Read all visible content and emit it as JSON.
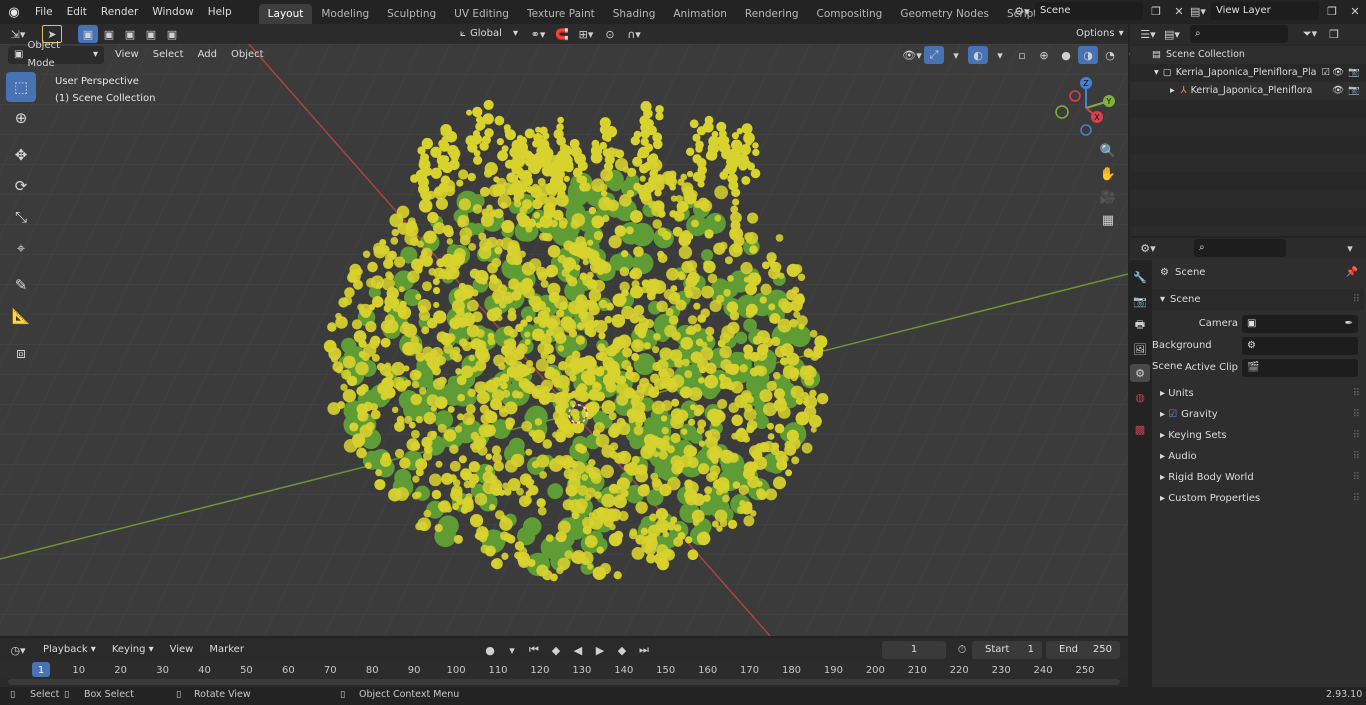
{
  "menu": {
    "items": [
      "File",
      "Edit",
      "Render",
      "Window",
      "Help"
    ]
  },
  "workspaces": {
    "tabs": [
      "Layout",
      "Modeling",
      "Sculpting",
      "UV Editing",
      "Texture Paint",
      "Shading",
      "Animation",
      "Rendering",
      "Compositing",
      "Geometry Nodes",
      "Scripting"
    ],
    "add_label": "+"
  },
  "scene_selector": {
    "value": "Scene"
  },
  "view_layer": {
    "value": "View Layer"
  },
  "header": {
    "mode": "Object Mode",
    "menus": [
      "View",
      "Select",
      "Add",
      "Object"
    ],
    "orientation": "Global",
    "options_label": "Options"
  },
  "viewport": {
    "overlay_line1": "User Perspective",
    "overlay_line2": "(1) Scene Collection",
    "gizmo": {
      "z": "Z",
      "y": "Y",
      "x": "X"
    },
    "colors": {
      "grid_bg": "#3b3b3b",
      "x_axis": "#b84650",
      "y_axis": "#7fa23d",
      "flower": "#d8d22e",
      "leaf": "#5f9c35"
    }
  },
  "outliner": {
    "root": "Scene Collection",
    "collection": "Kerria_Japonica_Pleniflora_Pla",
    "object": "Kerria_Japonica_Pleniflora"
  },
  "properties": {
    "context_title": "Scene",
    "section": "Scene",
    "camera_label": "Camera",
    "background_label": "Background Scene",
    "clip_label": "Active Clip",
    "panels": [
      "Units",
      "Gravity",
      "Keying Sets",
      "Audio",
      "Rigid Body World",
      "Custom Properties"
    ],
    "gravity_checked": true
  },
  "timeline": {
    "menus": [
      "Playback",
      "Keying",
      "View",
      "Marker"
    ],
    "current_frame": "1",
    "start_label": "Start",
    "start_value": "1",
    "end_label": "End",
    "end_value": "250",
    "ruler": [
      "1",
      "10",
      "20",
      "30",
      "40",
      "50",
      "60",
      "70",
      "80",
      "90",
      "100",
      "110",
      "120",
      "130",
      "140",
      "150",
      "160",
      "170",
      "180",
      "190",
      "200",
      "210",
      "220",
      "230",
      "240",
      "250"
    ]
  },
  "statusbar": {
    "select": "Select",
    "box_select": "Box Select",
    "rotate": "Rotate View",
    "context_menu": "Object Context Menu",
    "version": "2.93.10"
  }
}
